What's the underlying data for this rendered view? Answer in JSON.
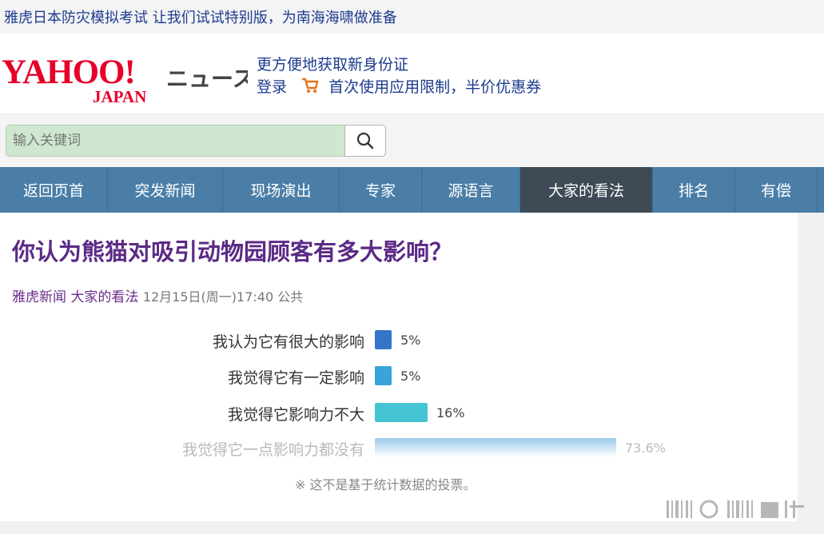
{
  "topbar": {
    "text": "雅虎日本防灾模拟考试 让我们试试特别版，为南海海啸做准备"
  },
  "header": {
    "logo_text": "YAHOO!",
    "logo_sub": "JAPAN",
    "news_label": "ニュース",
    "promo_line1": "更方便地获取新身份证",
    "login_label": "登录",
    "promo_line2": "首次使用应用限制，半价优惠券"
  },
  "search": {
    "placeholder": "输入关键词"
  },
  "nav": {
    "items": [
      {
        "label": "返回页首"
      },
      {
        "label": "突发新闻"
      },
      {
        "label": "现场演出"
      },
      {
        "label": "专家"
      },
      {
        "label": "源语言"
      },
      {
        "label": "大家的看法"
      },
      {
        "label": "排名"
      },
      {
        "label": "有偿"
      }
    ],
    "active": "大家的看法"
  },
  "article": {
    "question": "你认为熊猫对吸引动物园顾客有多大影响？",
    "source": "雅虎新闻 大家的看法",
    "timestamp": "12月15日(周一)17:40 公共"
  },
  "poll": {
    "options": [
      {
        "label": "我认为它有很大的影响",
        "percent_text": "5%",
        "value": 5,
        "color": "#3575c9"
      },
      {
        "label": "我觉得它有一定影响",
        "percent_text": "5%",
        "value": 5,
        "color": "#3aa3d8"
      },
      {
        "label": "我觉得它影响力不大",
        "percent_text": "16%",
        "value": 16,
        "color": "#45c4d3"
      },
      {
        "label": "我觉得它一点影响力都没有",
        "percent_text": "73.6%",
        "value": 73.6,
        "color": "#9ccaea"
      }
    ],
    "note": "※ 这不是基于统计数据的投票。"
  },
  "colors": {
    "nav_bg": "#4a7ea7",
    "nav_active": "#3e4a55",
    "question": "#5b2a86",
    "link": "#1d3b8f"
  }
}
